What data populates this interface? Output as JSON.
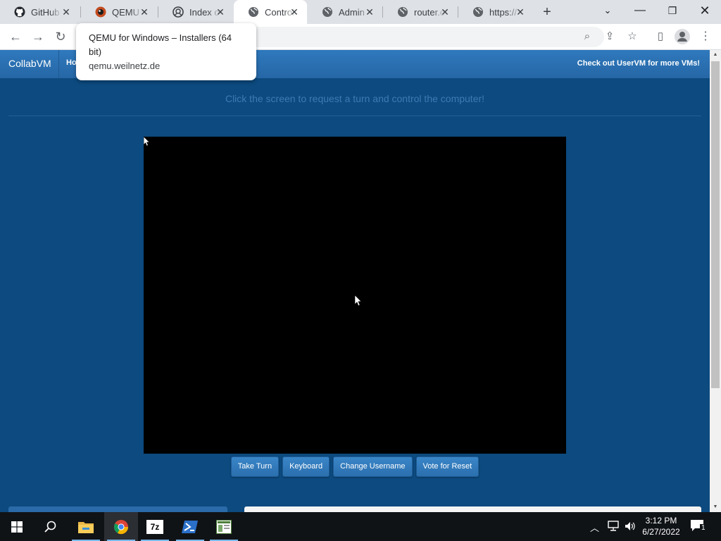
{
  "browser": {
    "tabs": [
      {
        "title": "GitHub",
        "icon": "github-icon"
      },
      {
        "title": "QEMU for Windows – Installers (64 bit)",
        "short": "QEMU f",
        "icon": "qemu-icon"
      },
      {
        "title": "Index of",
        "icon": "index-icon"
      },
      {
        "title": "Control",
        "icon": "globe-icon",
        "active": true
      },
      {
        "title": "Admin",
        "icon": "globe-icon"
      },
      {
        "title": "router.c",
        "icon": "globe-icon"
      },
      {
        "title": "https://",
        "icon": "globe-icon"
      }
    ],
    "tooltip": {
      "title": "QEMU for Windows – Installers (64 bit)",
      "url": "qemu.weilnetz.de"
    }
  },
  "site": {
    "brand": "CollabVM",
    "home": "Ho",
    "right_link": "Check out UserVM for more VMs!",
    "instruction": "Click the screen to request a turn and control the computer!",
    "buttons": {
      "take_turn": "Take Turn",
      "keyboard": "Keyboard",
      "change_username": "Change Username",
      "vote_reset": "Vote for Reset"
    }
  },
  "taskbar": {
    "time": "3:12 PM",
    "date": "6/27/2022",
    "notification_count": "1",
    "apps": [
      "file-explorer-icon",
      "chrome-icon",
      "7zip-icon",
      "powershell-icon",
      "app-icon"
    ]
  },
  "colors": {
    "page_bg": "#0c4a7f",
    "navbar": "#2f79bd",
    "button": "#3a86c8"
  }
}
